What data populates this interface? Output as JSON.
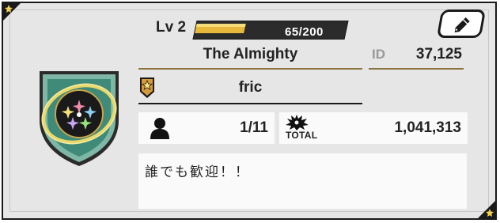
{
  "level": {
    "label": "Lv 2",
    "xp_text": "65/200",
    "xp_current": 65,
    "xp_max": 200
  },
  "guild": {
    "name": "The Almighty",
    "id_label": "ID",
    "id_value": "37,125",
    "leader_name": "fric",
    "members": "1/11",
    "total_label": "TOTAL",
    "total_value": "1,041,313",
    "description": "誰でも歓迎！！"
  },
  "icons": {
    "edit": "pencil-icon",
    "emblem": "guild-emblem-shield",
    "rank": "star-rank-badge-icon",
    "members": "person-icon",
    "total": "burst-icon",
    "corners": "star-corner-icon"
  },
  "colors": {
    "xp_fill": "#e7b93a",
    "underline_gold": "#8a7440",
    "emblem_green": "#3f8a78",
    "panel_bg": "#e6e6e6"
  }
}
